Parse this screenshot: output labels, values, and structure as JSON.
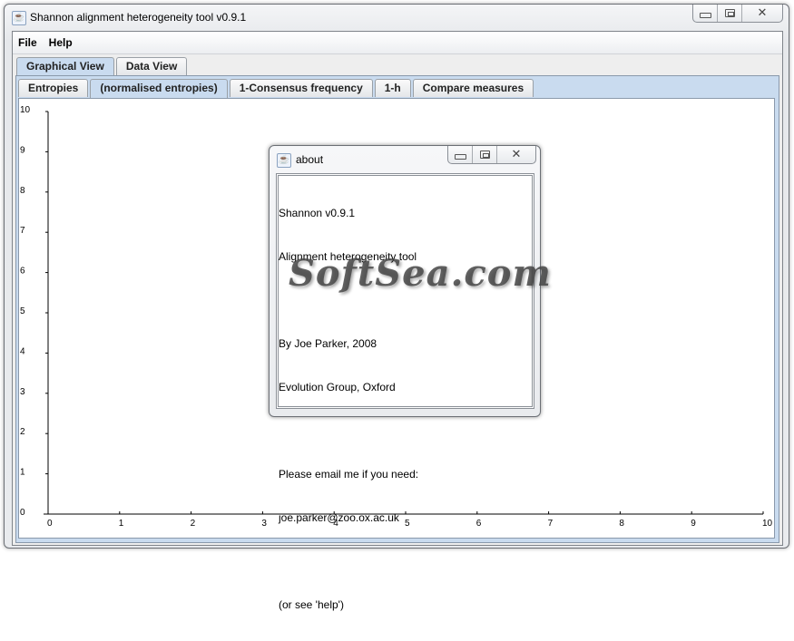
{
  "window": {
    "title": "Shannon alignment heterogeneity tool v0.9.1",
    "icon": "java-cup-icon",
    "controls": {
      "minimize": "minimize",
      "maximize": "maximize",
      "close": "close"
    }
  },
  "menubar": {
    "items": [
      {
        "label": "File"
      },
      {
        "label": "Help"
      }
    ]
  },
  "outer_tabs": [
    {
      "label": "Graphical View",
      "selected": true
    },
    {
      "label": "Data View",
      "selected": false
    }
  ],
  "inner_tabs": [
    {
      "label": "Entropies",
      "selected": false
    },
    {
      "label": "(normalised entropies)",
      "selected": true
    },
    {
      "label": "1-Consensus frequency",
      "selected": false
    },
    {
      "label": "1-h",
      "selected": false
    },
    {
      "label": "Compare measures",
      "selected": false
    }
  ],
  "chart_data": {
    "type": "line",
    "title": "",
    "xlabel": "",
    "ylabel": "",
    "xlim": [
      0,
      10
    ],
    "ylim": [
      0,
      10
    ],
    "x_ticks": [
      "0",
      "1",
      "2",
      "3",
      "4",
      "5",
      "6",
      "7",
      "8",
      "9",
      "10"
    ],
    "y_ticks": [
      "0",
      "1",
      "2",
      "3",
      "4",
      "5",
      "6",
      "7",
      "8",
      "9",
      "10"
    ],
    "series": [],
    "grid": false
  },
  "about_dialog": {
    "title": "about",
    "lines": [
      "Shannon v0.9.1",
      "Alignment heterogeneity tool",
      "",
      "By Joe Parker, 2008",
      "Evolution Group, Oxford",
      "",
      "Please email me if you need:",
      "joe.parker@zoo.ox.ac.uk",
      "",
      "(or see 'help')"
    ]
  },
  "watermark": "SoftSea.com",
  "colors": {
    "tab_selected": "#c9dbef",
    "panel": "#c9dbef",
    "plot_bg": "#ffffff"
  }
}
